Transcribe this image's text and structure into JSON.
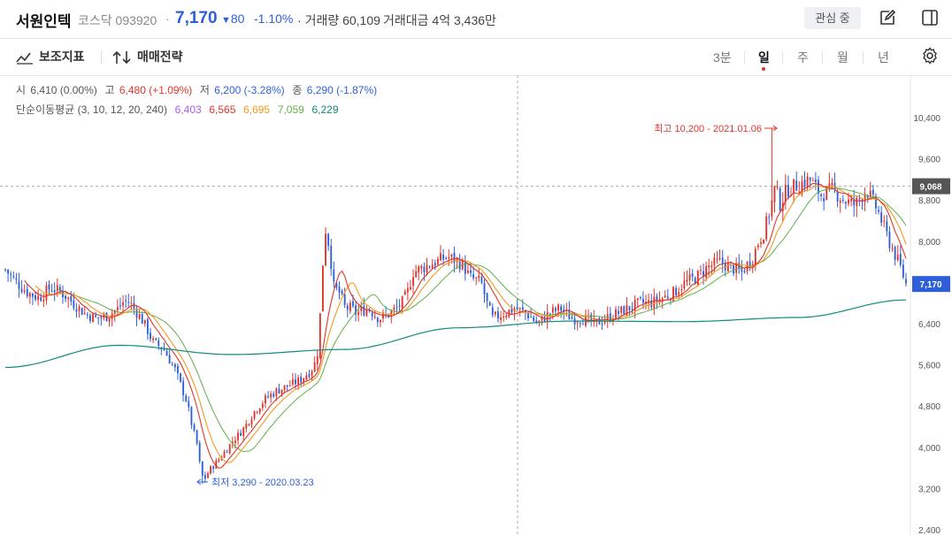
{
  "header": {
    "stock_name": "서원인텍",
    "market": "코스닥",
    "code": "093920",
    "price": "7,170",
    "change": "80",
    "change_pct": "-1.10%",
    "volume_label": "거래량",
    "volume": "60,109",
    "amount_label": "거래대금",
    "amount": "4억 3,436만",
    "favorite_label": "관심 중",
    "edit_icon": "edit-icon",
    "panel_icon": "panel-toggle-icon"
  },
  "toolbar": {
    "indicator_label": "보조지표",
    "strategy_label": "매매전략",
    "periods": [
      "3분",
      "일",
      "주",
      "월",
      "년"
    ],
    "active_period": "일",
    "settings_icon": "gear-icon"
  },
  "ohlc_info": {
    "open_label": "시",
    "open": "6,410 (0.00%)",
    "high_label": "고",
    "high": "6,480 (+1.09%)",
    "low_label": "저",
    "low": "6,200 (-3.28%)",
    "close_label": "종",
    "close": "6,290 (-1.87%)"
  },
  "ma_info": {
    "label": "단순이동평균 (3, 10, 12, 20, 240)",
    "values": [
      "6,403",
      "6,565",
      "6,695",
      "7,059",
      "6,229"
    ],
    "colors": [
      "#a95fe8",
      "#e0342b",
      "#f39a1c",
      "#5fb04a",
      "#138a7e"
    ]
  },
  "colors": {
    "up": "#e0342b",
    "down": "#2f5fd8",
    "ma240": "#138a7e",
    "ma20": "#5fb04a",
    "ma10": "#e0342b",
    "ma12": "#f39a1c"
  },
  "chart_data": {
    "type": "candlestick",
    "x_range_label": "daily",
    "y_ticks": [
      2400,
      3200,
      4000,
      4800,
      5600,
      6400,
      7200,
      8000,
      8800,
      9600,
      10400
    ],
    "y_tick_labels": [
      "2,400",
      "3,200",
      "4,000",
      "4,800",
      "5,600",
      "6,400",
      "7,200",
      "8,000",
      "8,800",
      "9,600",
      "10,400"
    ],
    "ylim": [
      2400,
      10800
    ],
    "crosshair_value": "9,068",
    "current_value": "7,170",
    "high_annotation": "최고 10,200 - 2021.01.06",
    "low_annotation": "최저 3,290 - 2020.03.23",
    "close_path": [
      [
        0,
        7450
      ],
      [
        10,
        7200
      ],
      [
        20,
        7000
      ],
      [
        30,
        6900
      ],
      [
        40,
        7100
      ],
      [
        50,
        7000
      ],
      [
        60,
        6800
      ],
      [
        70,
        6600
      ],
      [
        80,
        6500
      ],
      [
        90,
        6550
      ],
      [
        100,
        6700
      ],
      [
        105,
        6850
      ],
      [
        110,
        6800
      ],
      [
        120,
        6500
      ],
      [
        125,
        6300
      ],
      [
        130,
        6050
      ],
      [
        140,
        5900
      ],
      [
        150,
        5500
      ],
      [
        160,
        4900
      ],
      [
        165,
        4400
      ],
      [
        170,
        4000
      ],
      [
        172,
        3600
      ],
      [
        175,
        3350
      ],
      [
        180,
        3550
      ],
      [
        190,
        3800
      ],
      [
        200,
        4100
      ],
      [
        210,
        4350
      ],
      [
        220,
        4700
      ],
      [
        230,
        4950
      ],
      [
        240,
        5100
      ],
      [
        250,
        5200
      ],
      [
        260,
        5300
      ],
      [
        270,
        5500
      ],
      [
        275,
        5700
      ],
      [
        278,
        6600
      ],
      [
        280,
        7500
      ],
      [
        283,
        8300
      ],
      [
        287,
        7700
      ],
      [
        290,
        7100
      ],
      [
        295,
        7000
      ],
      [
        300,
        6700
      ],
      [
        305,
        6700
      ],
      [
        310,
        6600
      ],
      [
        320,
        6700
      ],
      [
        330,
        6500
      ],
      [
        340,
        6600
      ],
      [
        350,
        6800
      ],
      [
        355,
        7000
      ],
      [
        360,
        7400
      ],
      [
        370,
        7500
      ],
      [
        380,
        7600
      ],
      [
        390,
        7700
      ],
      [
        400,
        7600
      ],
      [
        405,
        7500
      ],
      [
        410,
        7300
      ],
      [
        420,
        7200
      ],
      [
        425,
        6800
      ],
      [
        430,
        6500
      ],
      [
        440,
        6600
      ],
      [
        450,
        6700
      ],
      [
        460,
        6600
      ],
      [
        470,
        6400
      ],
      [
        480,
        6600
      ],
      [
        490,
        6700
      ],
      [
        500,
        6500
      ],
      [
        510,
        6500
      ],
      [
        520,
        6400
      ],
      [
        530,
        6500
      ],
      [
        540,
        6600
      ],
      [
        550,
        6700
      ],
      [
        560,
        6800
      ],
      [
        570,
        6800
      ],
      [
        580,
        6900
      ],
      [
        590,
        7000
      ],
      [
        600,
        7200
      ],
      [
        610,
        7300
      ],
      [
        620,
        7500
      ],
      [
        630,
        7600
      ],
      [
        640,
        7500
      ],
      [
        650,
        7400
      ],
      [
        660,
        7700
      ],
      [
        665,
        8000
      ],
      [
        670,
        8200
      ],
      [
        675,
        8600
      ],
      [
        680,
        9100
      ],
      [
        683,
        8700
      ],
      [
        690,
        9000
      ],
      [
        700,
        9100
      ],
      [
        710,
        9200
      ],
      [
        720,
        8900
      ],
      [
        730,
        9000
      ],
      [
        740,
        8800
      ],
      [
        750,
        8700
      ],
      [
        760,
        9000
      ],
      [
        770,
        8600
      ],
      [
        780,
        8000
      ],
      [
        790,
        7500
      ],
      [
        795,
        7170
      ]
    ],
    "ma_series": [
      {
        "name": "240",
        "points": [
          [
            0,
            5550
          ],
          [
            100,
            5980
          ],
          [
            200,
            5800
          ],
          [
            300,
            5900
          ],
          [
            400,
            6320
          ],
          [
            500,
            6450
          ],
          [
            600,
            6440
          ],
          [
            700,
            6520
          ],
          [
            795,
            6860
          ]
        ]
      }
    ]
  }
}
